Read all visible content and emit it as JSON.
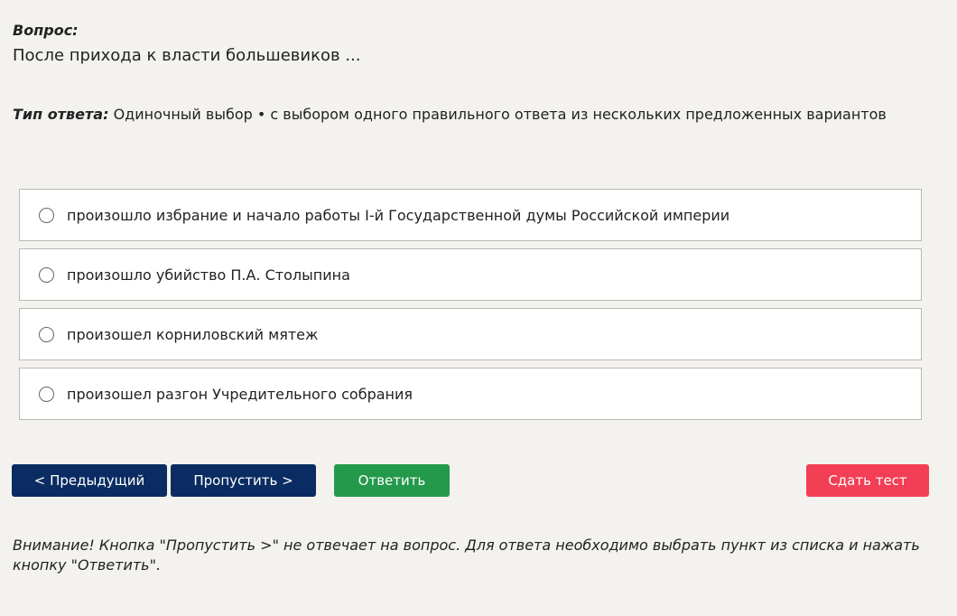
{
  "question": {
    "label": "Вопрос:",
    "text": "После прихода к власти большевиков ..."
  },
  "answer_type": {
    "label": "Тип ответа:",
    "value": "Одиночный выбор • с выбором одного правильного ответа из нескольких предложенных вариантов"
  },
  "options": [
    {
      "text": "произошло избрание и начало работы I-й Государственной думы Российской империи",
      "selected": false
    },
    {
      "text": "произошло убийство П.А. Столыпина",
      "selected": false
    },
    {
      "text": "произошел корниловский мятеж",
      "selected": false
    },
    {
      "text": "произошел разгон Учредительного собрания",
      "selected": false
    }
  ],
  "buttons": {
    "prev": "< Предыдущий",
    "skip": "Пропустить >",
    "answer": "Ответить",
    "submit": "Сдать тест"
  },
  "notice": "Внимание! Кнопка \"Пропустить >\" не отвечает на вопрос. Для ответа необходимо выбрать пункт из списка и нажать кнопку \"Ответить\".",
  "colors": {
    "background": "#f3f2ef",
    "nav_button": "#0b2c62",
    "answer_button": "#23994c",
    "submit_button": "#f23f55"
  }
}
